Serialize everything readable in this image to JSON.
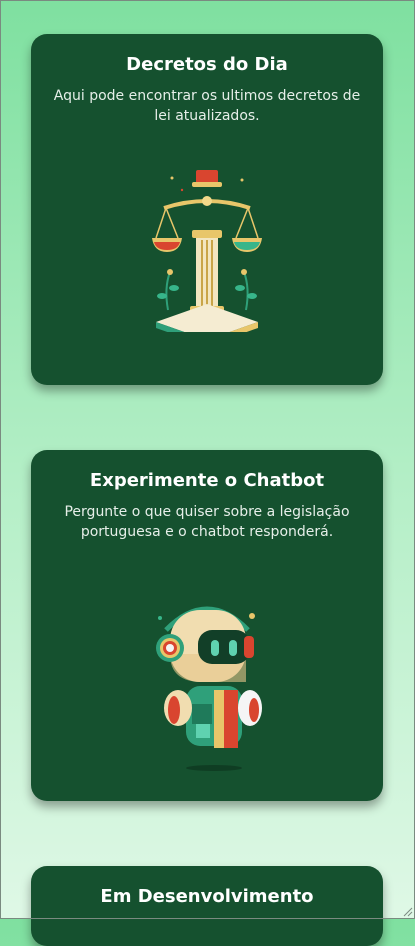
{
  "cards": [
    {
      "title": "Decretos do Dia",
      "description": "Aqui pode encontrar os ultimos decretos de lei atualizados.",
      "icon": "scales-of-justice-icon"
    },
    {
      "title": "Experimente o Chatbot",
      "description": "Pergunte o que quiser sobre a legislação portuguesa e o chatbot responderá.",
      "icon": "robot-chatbot-icon"
    },
    {
      "title": "Em Desenvolvimento"
    }
  ],
  "colors": {
    "card_bg": "#15512f",
    "page_gradient_top": "#7fe0a0",
    "page_gradient_bottom": "#dff8e6"
  }
}
